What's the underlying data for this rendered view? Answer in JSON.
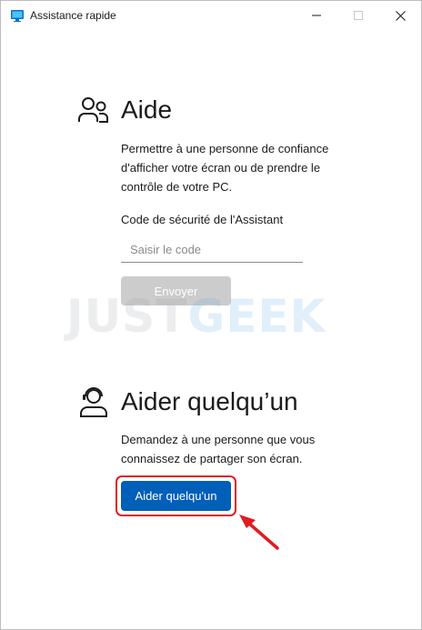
{
  "window": {
    "title": "Assistance rapide",
    "minimize_icon": "minimize-icon",
    "maximize_icon": "maximize-icon",
    "close_icon": "close-icon"
  },
  "get_help": {
    "icon": "people-icon",
    "title": "Aide",
    "description_line1": "Permettre à une personne de confiance",
    "description_line2": "d'afficher votre écran ou de prendre le",
    "description_line3": "contrôle de votre PC.",
    "code_label": "Code de sécurité de l'Assistant",
    "code_value": "",
    "code_placeholder": "Saisir le code",
    "submit_label": "Envoyer"
  },
  "watermark": {
    "part1": "JUST",
    "part2": "GEEK"
  },
  "give_help": {
    "icon": "person-headset-icon",
    "title": "Aider quelqu’un",
    "description_line1": "Demandez à une personne que vous",
    "description_line2": "connaissez de partager son écran.",
    "button_label": "Aider quelqu'un"
  },
  "colors": {
    "accent": "#005fb8",
    "highlight": "#e11b22",
    "disabled_button": "#cccccc"
  }
}
